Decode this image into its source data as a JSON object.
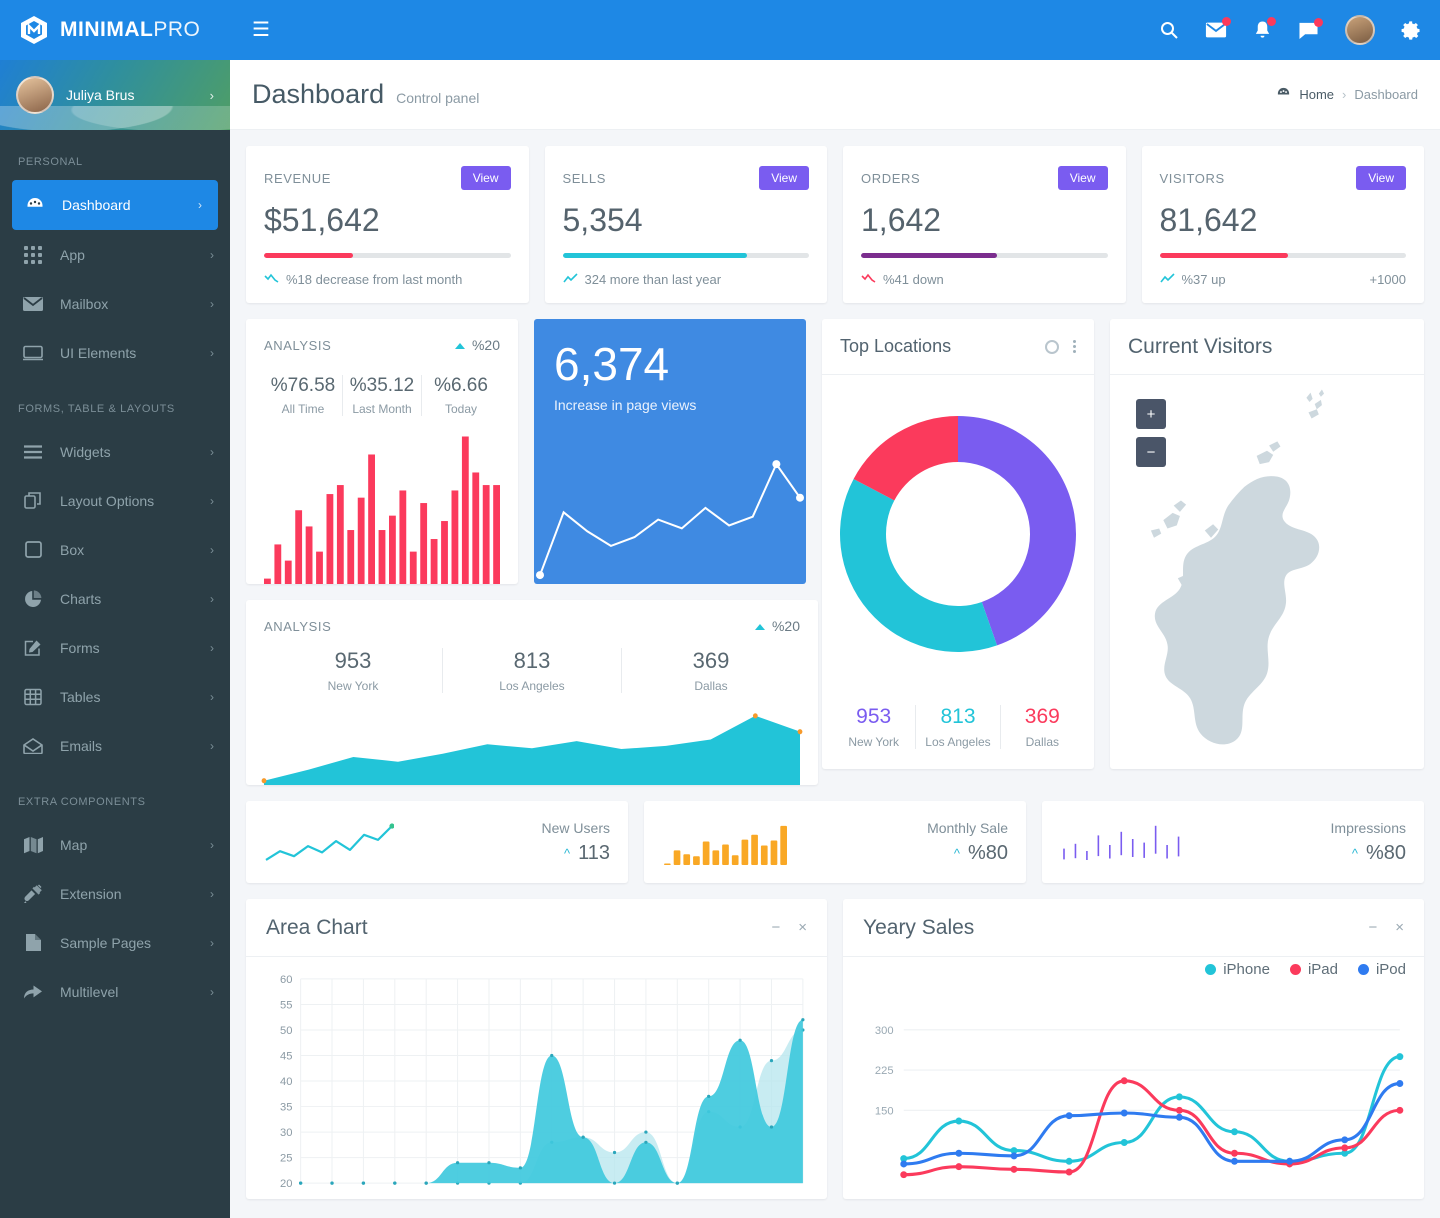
{
  "brand": {
    "bold": "MINIMAL",
    "light": "PRO"
  },
  "topbar": {
    "menu_icon": "hamburger-icon",
    "icons": [
      "search-icon",
      "mail-icon",
      "bell-icon",
      "chat-icon",
      "avatar",
      "gear-icon"
    ]
  },
  "profile": {
    "name": "Juliya Brus",
    "chevron": "›"
  },
  "sidebar": {
    "sections": [
      {
        "title": "PERSONAL",
        "items": [
          {
            "label": "Dashboard",
            "icon": "dashboard-icon",
            "active": true
          },
          {
            "label": "App",
            "icon": "grid-icon",
            "active": false
          },
          {
            "label": "Mailbox",
            "icon": "envelope-icon",
            "active": false
          },
          {
            "label": "UI Elements",
            "icon": "window-icon",
            "active": false
          }
        ]
      },
      {
        "title": "FORMS, TABLE & LAYOUTS",
        "items": [
          {
            "label": "Widgets",
            "icon": "list-icon",
            "active": false
          },
          {
            "label": "Layout Options",
            "icon": "layout-icon",
            "active": false
          },
          {
            "label": "Box",
            "icon": "square-icon",
            "active": false
          },
          {
            "label": "Charts",
            "icon": "pie-chart-icon",
            "active": false
          },
          {
            "label": "Forms",
            "icon": "edit-icon",
            "active": false
          },
          {
            "label": "Tables",
            "icon": "table-icon",
            "active": false
          },
          {
            "label": "Emails",
            "icon": "open-envelope-icon",
            "active": false
          }
        ]
      },
      {
        "title": "EXTRA COMPONENTS",
        "items": [
          {
            "label": "Map",
            "icon": "map-icon",
            "active": false
          },
          {
            "label": "Extension",
            "icon": "plug-icon",
            "active": false
          },
          {
            "label": "Sample Pages",
            "icon": "file-icon",
            "active": false
          },
          {
            "label": "Multilevel",
            "icon": "arrow-right-icon",
            "active": false
          }
        ]
      }
    ]
  },
  "page": {
    "title": "Dashboard",
    "subtitle": "Control panel",
    "breadcrumb": {
      "icon": "dashboard-icon",
      "home": "Home",
      "sep": "›",
      "current": "Dashboard"
    }
  },
  "stats": [
    {
      "label": "REVENUE",
      "value": "$51,642",
      "button": "View",
      "progress": 36,
      "color": "#fb3a5c",
      "trend_icon": "trend-down-icon",
      "foot": "%18 decrease from last month",
      "extra": ""
    },
    {
      "label": "SELLS",
      "value": "5,354",
      "button": "View",
      "progress": 75,
      "color": "#22c4d8",
      "trend_icon": "trend-up-icon",
      "foot": "324 more than last year",
      "extra": ""
    },
    {
      "label": "ORDERS",
      "value": "1,642",
      "button": "View",
      "progress": 55,
      "color": "#7b2d8e",
      "trend_icon": "trend-down-icon",
      "foot": "%41 down",
      "extra": ""
    },
    {
      "label": "VISITORS",
      "value": "81,642",
      "button": "View",
      "progress": 52,
      "color": "#fb3a5c",
      "trend_icon": "trend-up-icon",
      "foot": "%37 up",
      "extra": "+1000"
    }
  ],
  "analysis_small": {
    "title": "ANALYSIS",
    "delta": "%20",
    "delta_icon": "triangle-up-icon",
    "cols": [
      {
        "num": "%76.58",
        "sub": "All Time"
      },
      {
        "num": "%35.12",
        "sub": "Last Month"
      },
      {
        "num": "%6.66",
        "sub": "Today"
      }
    ]
  },
  "page_views": {
    "value": "6,374",
    "label": "Increase in page views"
  },
  "top_locations": {
    "title": "Top Locations",
    "actions": [
      "circle-icon",
      "more-vertical-icon"
    ],
    "legend": [
      {
        "num": "953",
        "sub": "New York",
        "color": "#7a5cf0"
      },
      {
        "num": "813",
        "sub": "Los Angeles",
        "color": "#22c4d8"
      },
      {
        "num": "369",
        "sub": "Dallas",
        "color": "#fb3a5c"
      }
    ]
  },
  "current_visitors": {
    "title": "Current Visitors",
    "zoom_in": "+",
    "zoom_out": "−"
  },
  "analysis_big": {
    "title": "ANALYSIS",
    "delta": "%20",
    "delta_icon": "triangle-up-icon",
    "cols": [
      {
        "num": "953",
        "sub": "New York"
      },
      {
        "num": "813",
        "sub": "Los Angeles"
      },
      {
        "num": "369",
        "sub": "Dallas"
      }
    ]
  },
  "mini_widgets": [
    {
      "label": "New Users",
      "value": "113",
      "arrow": "^",
      "chart": "line",
      "color": "#22c4d8"
    },
    {
      "label": "Monthly Sale",
      "value": "%80",
      "arrow": "^",
      "chart": "bar",
      "color": "#f9a825"
    },
    {
      "label": "Impressions",
      "value": "%80",
      "arrow": "^",
      "chart": "candle",
      "color": "#7a5cf0"
    }
  ],
  "area_chart_panel": {
    "title": "Area Chart",
    "minimize": "−",
    "close": "×"
  },
  "yearly_panel": {
    "title": "Yeary Sales",
    "minimize": "−",
    "close": "×"
  },
  "chart_data": [
    {
      "type": "bar",
      "name": "analysis-small-bars",
      "title": "ANALYSIS",
      "categories": [
        "1",
        "2",
        "3",
        "4",
        "5",
        "6",
        "7",
        "8",
        "9",
        "10",
        "11",
        "12",
        "13",
        "14",
        "15",
        "16",
        "17",
        "18",
        "19",
        "20",
        "21",
        "22",
        "23"
      ],
      "values": [
        3,
        22,
        13,
        41,
        32,
        18,
        50,
        55,
        30,
        48,
        72,
        30,
        38,
        52,
        18,
        45,
        25,
        35,
        52,
        82,
        62,
        55,
        55
      ],
      "ylim": [
        0,
        90
      ],
      "color": "#fb3a5c",
      "xlabel": "",
      "ylabel": "",
      "grid": false
    },
    {
      "type": "line",
      "name": "page-views-sparkline",
      "title": "Increase in page views",
      "x": [
        0,
        1,
        2,
        3,
        4,
        5,
        6,
        7,
        8,
        9,
        10,
        11
      ],
      "values": [
        2,
        45,
        32,
        22,
        28,
        40,
        34,
        48,
        36,
        42,
        78,
        55
      ],
      "ylim": [
        0,
        100
      ],
      "color": "#ffffff",
      "grid": false,
      "legend": "none"
    },
    {
      "type": "pie",
      "name": "top-locations-donut",
      "title": "Top Locations",
      "labels": [
        "New York",
        "Los Angeles",
        "Dallas"
      ],
      "values": [
        953,
        813,
        369
      ],
      "colors": [
        "#7a5cf0",
        "#22c4d8",
        "#fb3a5c"
      ],
      "donut": true,
      "legend": "bottom"
    },
    {
      "type": "area",
      "name": "analysis-big-area",
      "title": "ANALYSIS",
      "x": [
        0,
        1,
        2,
        3,
        4,
        5,
        6,
        7,
        8,
        9,
        10,
        11,
        12
      ],
      "values": [
        0,
        14,
        30,
        24,
        34,
        46,
        41,
        50,
        40,
        44,
        52,
        82,
        62
      ],
      "ylim": [
        0,
        100
      ],
      "color": "#22c4d8",
      "grid": false
    },
    {
      "type": "line",
      "name": "new-users-sparkline",
      "title": "New Users",
      "values": [
        8,
        22,
        14,
        30,
        20,
        38,
        24,
        48,
        40,
        62
      ],
      "ylim": [
        0,
        70
      ],
      "color": "#22c4d8",
      "grid": false
    },
    {
      "type": "bar",
      "name": "monthly-sale-bars",
      "title": "Monthly Sale",
      "values": [
        3,
        30,
        22,
        18,
        48,
        30,
        42,
        20,
        52,
        62,
        40,
        50,
        80
      ],
      "ylim": [
        0,
        90
      ],
      "color": "#f9a825",
      "grid": false
    },
    {
      "type": "bar",
      "name": "impressions-candles",
      "title": "Impressions",
      "values": [
        24,
        32,
        20,
        46,
        30,
        52,
        40,
        34,
        62,
        30,
        44
      ],
      "ylim": [
        0,
        70
      ],
      "color": "#7a5cf0",
      "grid": false
    },
    {
      "type": "area",
      "name": "area-chart-main",
      "title": "Area Chart",
      "xlabel": "",
      "ylabel": "",
      "ylim": [
        20,
        60
      ],
      "yticks": [
        20,
        25,
        30,
        35,
        40,
        45,
        50,
        55,
        60
      ],
      "grid": true,
      "series": [
        {
          "name": "series-1",
          "color": "#3fc9dd",
          "values": [
            16,
            14,
            15,
            17,
            16,
            24,
            24,
            23,
            45,
            29,
            20,
            28,
            14,
            37,
            48,
            31,
            52
          ]
        },
        {
          "name": "series-2",
          "color": "#b6e6ee",
          "values": [
            13,
            12,
            13,
            14,
            13,
            18,
            19,
            20,
            28,
            29,
            26,
            30,
            12,
            34,
            31,
            44,
            50
          ]
        }
      ]
    },
    {
      "type": "line",
      "name": "yearly-sales-lines",
      "title": "Yeary Sales",
      "ylim": [
        0,
        340
      ],
      "yticks": [
        150,
        225,
        300
      ],
      "grid": true,
      "legend": "top-right",
      "series": [
        {
          "name": "iPhone",
          "color": "#22c4d8",
          "values": [
            60,
            130,
            75,
            55,
            90,
            175,
            110,
            55,
            70,
            250
          ]
        },
        {
          "name": "iPad",
          "color": "#fb3a5c",
          "values": [
            30,
            45,
            40,
            35,
            205,
            150,
            70,
            50,
            80,
            150
          ]
        },
        {
          "name": "iPod",
          "color": "#2f7bf0",
          "values": [
            50,
            70,
            65,
            140,
            145,
            137,
            55,
            55,
            95,
            200
          ]
        }
      ]
    }
  ]
}
